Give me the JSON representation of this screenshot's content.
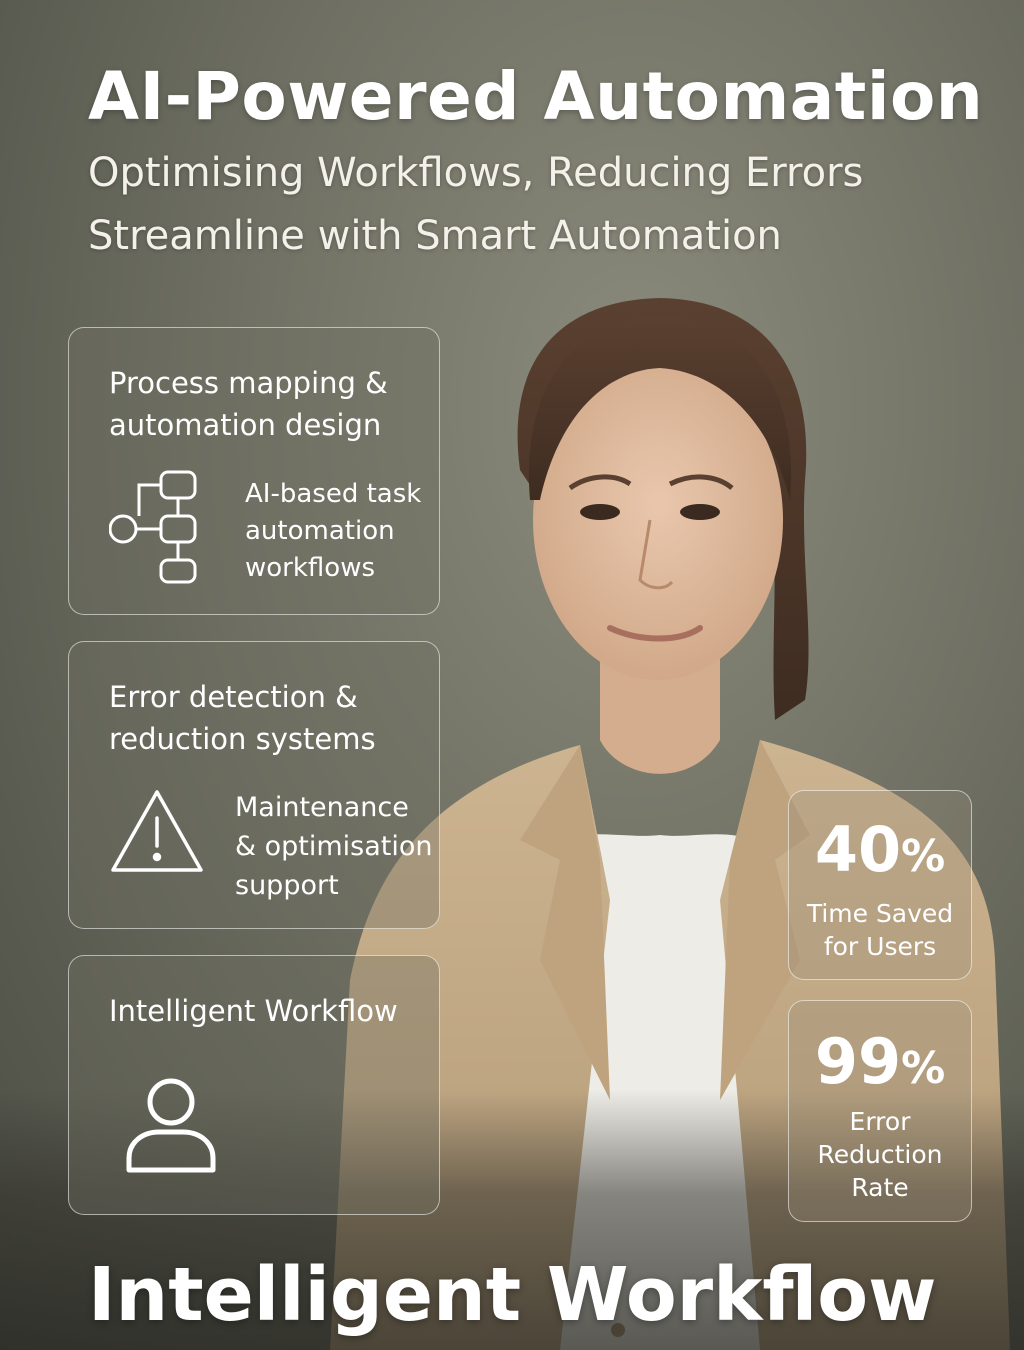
{
  "header": {
    "title": "AI-Powered Automation",
    "subtitle_line1": "Optimising Workflows, Reducing Errors",
    "subtitle_line2": "Streamline with Smart Automation"
  },
  "cards": [
    {
      "title": "Process mapping & automation design",
      "text": "AI-based task automation workflows",
      "icon": "workflow-diagram-icon"
    },
    {
      "title": "Error detection & reduction systems",
      "text": "Maintenance & optimisation support",
      "icon": "warning-icon"
    },
    {
      "title": "Intelligent Workflow",
      "icon": "user-icon"
    }
  ],
  "stats": [
    {
      "number": "40",
      "unit": "%",
      "label": "Time Saved for Users"
    },
    {
      "number": "99",
      "unit": "%",
      "label": "Error Reduction Rate"
    }
  ],
  "footer": {
    "headline": "Intelligent Workflow"
  },
  "colors": {
    "background": "#6f7063",
    "card_border": "#ffffff",
    "blazer": "#c9b08c",
    "text": "#ffffff"
  }
}
